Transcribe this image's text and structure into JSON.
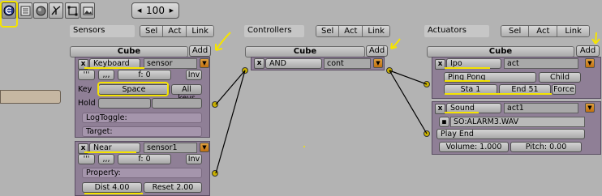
{
  "toolbar": {
    "icons": [
      "logic-icon",
      "script-icon",
      "sphere-icon",
      "physics-icon",
      "object-icon",
      "image-icon"
    ],
    "zoom": "100",
    "zoom_dec": "◀",
    "zoom_inc": "▶"
  },
  "sections": {
    "sensors": "Sensors",
    "controllers": "Controllers",
    "actuators": "Actuators",
    "sel": "Sel",
    "act": "Act",
    "link": "Link"
  },
  "sensors": {
    "object": "Cube",
    "add": "Add",
    "keyboard": {
      "type": "Keyboard",
      "name": "sensor",
      "f_label": "f: 0",
      "inv": "Inv",
      "key_label": "Key",
      "key_value": "Space",
      "all_keys": "All keys",
      "hold": "Hold",
      "logtoggle": "LogToggle:",
      "target": "Target:"
    },
    "near": {
      "type": "Near",
      "name": "sensor1",
      "f_label": "f: 0",
      "inv": "Inv",
      "property": "Property:",
      "dist": "Dist 4.00",
      "reset": "Reset 2.00"
    }
  },
  "controllers": {
    "object": "Cube",
    "add": "Add",
    "type": "AND",
    "name": "cont"
  },
  "actuators": {
    "object": "Cube",
    "add": "Add",
    "ipo": {
      "type": "Ipo",
      "name": "act",
      "mode": "Ping Pong",
      "child": "Child",
      "sta": "Sta 1",
      "end": "End 51",
      "force": "Force"
    },
    "sound": {
      "type": "Sound",
      "name": "act1",
      "file": "SO:ALARM3.WAV",
      "play": "Play End",
      "volume": "Volume: 1.000",
      "pitch": "Pitch: 0.00"
    }
  }
}
